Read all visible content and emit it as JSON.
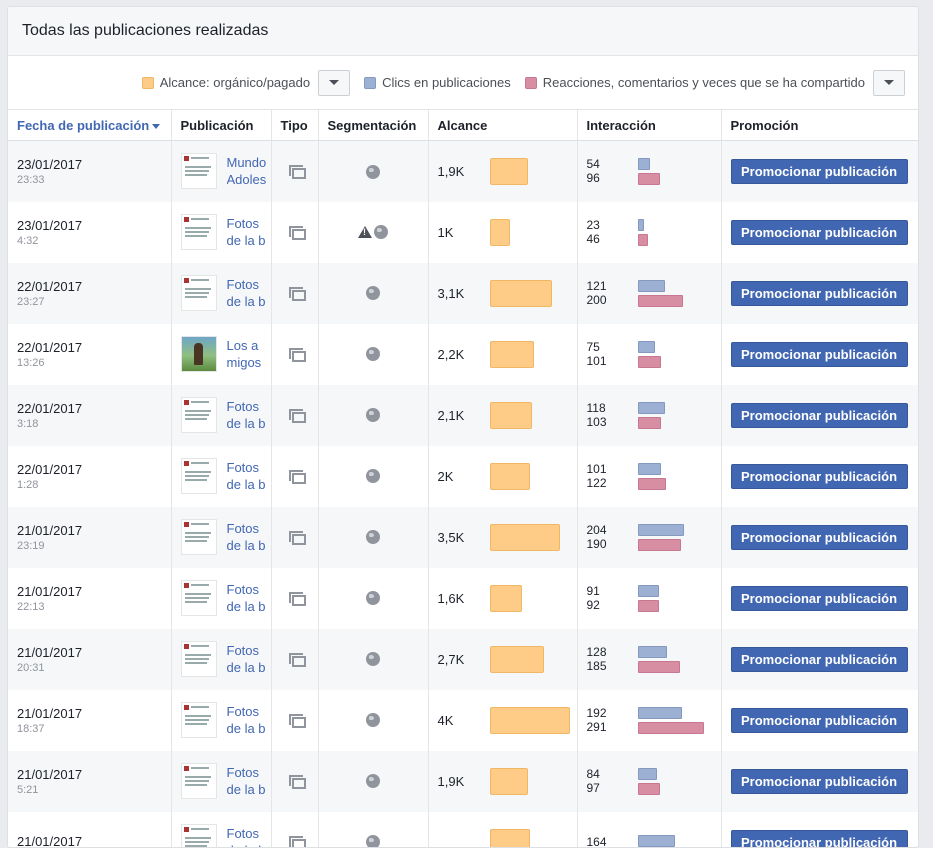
{
  "panel": {
    "title": "Todas las publicaciones realizadas"
  },
  "legend": {
    "reach_label": "Alcance: orgánico/pagado",
    "clicks_label": "Clics en publicaciones",
    "reactions_label": "Reacciones, comentarios y veces que se ha compartido",
    "colors": {
      "reach": "#ffcc88",
      "clicks": "#9cb0d4",
      "reactions": "#d88ea2"
    }
  },
  "table": {
    "headers": {
      "date": "Fecha de publicación",
      "post": "Publicación",
      "type": "Tipo",
      "targeting": "Segmentación",
      "reach": "Alcance",
      "engagement": "Interacción",
      "promotion": "Promoción"
    },
    "promote_label": "Promocionar publicación",
    "max_reach": 4000,
    "max_engagement": 291,
    "rows": [
      {
        "date": "23/01/2017",
        "time": "23:33",
        "title": "Mundo Adoles",
        "thumb": "text",
        "warning": false,
        "reach_label": "1,9K",
        "reach": 1900,
        "clicks": "54",
        "reactions": "96"
      },
      {
        "date": "23/01/2017",
        "time": "4:32",
        "title": "Fotos de la b",
        "thumb": "text",
        "warning": true,
        "reach_label": "1K",
        "reach": 1000,
        "clicks": "23",
        "reactions": "46"
      },
      {
        "date": "22/01/2017",
        "time": "23:27",
        "title": "Fotos de la b",
        "thumb": "text",
        "warning": false,
        "reach_label": "3,1K",
        "reach": 3100,
        "clicks": "121",
        "reactions": "200"
      },
      {
        "date": "22/01/2017",
        "time": "13:26",
        "title": "Los a migos",
        "thumb": "image",
        "warning": false,
        "reach_label": "2,2K",
        "reach": 2200,
        "clicks": "75",
        "reactions": "101"
      },
      {
        "date": "22/01/2017",
        "time": "3:18",
        "title": "Fotos de la b",
        "thumb": "text",
        "warning": false,
        "reach_label": "2,1K",
        "reach": 2100,
        "clicks": "118",
        "reactions": "103"
      },
      {
        "date": "22/01/2017",
        "time": "1:28",
        "title": "Fotos de la b",
        "thumb": "text",
        "warning": false,
        "reach_label": "2K",
        "reach": 2000,
        "clicks": "101",
        "reactions": "122"
      },
      {
        "date": "21/01/2017",
        "time": "23:19",
        "title": "Fotos de la b",
        "thumb": "text",
        "warning": false,
        "reach_label": "3,5K",
        "reach": 3500,
        "clicks": "204",
        "reactions": "190"
      },
      {
        "date": "21/01/2017",
        "time": "22:13",
        "title": "Fotos de la b",
        "thumb": "text",
        "warning": false,
        "reach_label": "1,6K",
        "reach": 1600,
        "clicks": "91",
        "reactions": "92"
      },
      {
        "date": "21/01/2017",
        "time": "20:31",
        "title": "Fotos de la b",
        "thumb": "text",
        "warning": false,
        "reach_label": "2,7K",
        "reach": 2700,
        "clicks": "128",
        "reactions": "185"
      },
      {
        "date": "21/01/2017",
        "time": "18:37",
        "title": "Fotos de la b",
        "thumb": "text",
        "warning": false,
        "reach_label": "4K",
        "reach": 4000,
        "clicks": "192",
        "reactions": "291"
      },
      {
        "date": "21/01/2017",
        "time": "5:21",
        "title": "Fotos de la b",
        "thumb": "text",
        "warning": false,
        "reach_label": "1,9K",
        "reach": 1900,
        "clicks": "84",
        "reactions": "97"
      },
      {
        "date": "21/01/2017",
        "time": "",
        "title": "Fotos de la b",
        "thumb": "text",
        "warning": false,
        "reach_label": "",
        "reach": 2000,
        "clicks": "164",
        "reactions": ""
      }
    ]
  }
}
